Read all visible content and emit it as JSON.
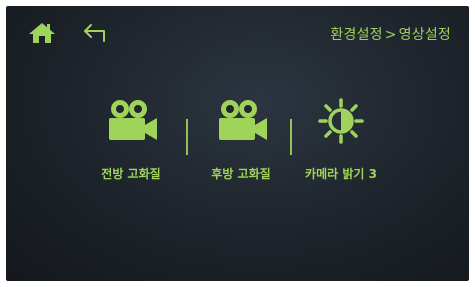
{
  "header": {
    "breadcrumb_parent": "환경설정",
    "breadcrumb_separator": ">",
    "breadcrumb_current": "영상설정"
  },
  "menu": {
    "items": [
      {
        "label": "전방 고화질",
        "icon": "video-camera-icon"
      },
      {
        "label": "후방 고화질",
        "icon": "video-camera-icon"
      },
      {
        "label": "카메라 밝기 3",
        "icon": "brightness-icon"
      }
    ]
  },
  "colors": {
    "accent": "#9fd35a",
    "background": "#1d232a"
  }
}
